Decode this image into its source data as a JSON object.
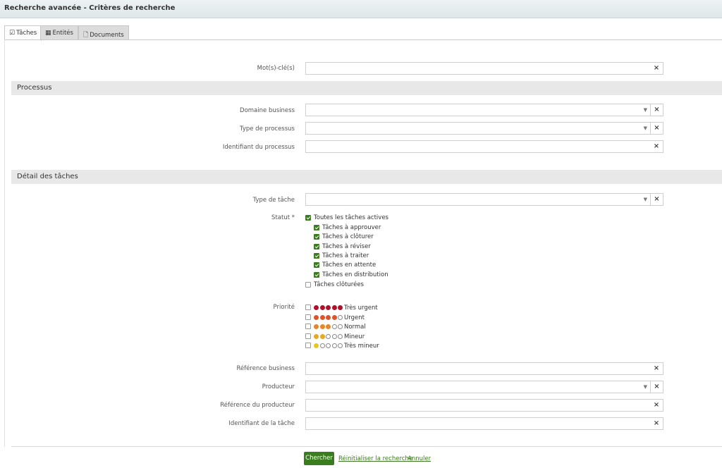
{
  "window": {
    "title": "Recherche avancée - Critères de recherche"
  },
  "tabs": [
    {
      "label": "Tâches",
      "icon": "checkbox-icon",
      "active": true
    },
    {
      "label": "Entités",
      "icon": "building-icon",
      "active": false
    },
    {
      "label": "Documents",
      "icon": "document-icon",
      "active": false
    }
  ],
  "keywords": {
    "label": "Mot(s)-clé(s)",
    "value": "",
    "clear": "×"
  },
  "processus": {
    "title": "Processus",
    "domaine": {
      "label": "Domaine business",
      "value": ""
    },
    "type": {
      "label": "Type de processus",
      "value": ""
    },
    "identifiant": {
      "label": "Identifiant du processus",
      "value": ""
    }
  },
  "details": {
    "title": "Détail des tâches",
    "type_tache": {
      "label": "Type de tâche",
      "value": ""
    },
    "statut": {
      "label": "Statut *",
      "options": [
        {
          "label": "Toutes les tâches actives",
          "checked": true,
          "indent": 0
        },
        {
          "label": "Tâches à approuver",
          "checked": true,
          "indent": 1
        },
        {
          "label": "Tâches à clôturer",
          "checked": true,
          "indent": 1
        },
        {
          "label": "Tâches à réviser",
          "checked": true,
          "indent": 1
        },
        {
          "label": "Tâches à traiter",
          "checked": true,
          "indent": 1
        },
        {
          "label": "Tâches en attente",
          "checked": true,
          "indent": 1
        },
        {
          "label": "Tâches en distribution",
          "checked": true,
          "indent": 1
        },
        {
          "label": "Tâches clôturées",
          "checked": false,
          "indent": 0
        }
      ]
    },
    "priorite": {
      "label": "Priorité",
      "options": [
        {
          "label": "Très urgent",
          "filled": 5,
          "color": "#b0102a"
        },
        {
          "label": "Urgent",
          "filled": 4,
          "color": "#e0522a"
        },
        {
          "label": "Normal",
          "filled": 3,
          "color": "#e8842a"
        },
        {
          "label": "Mineur",
          "filled": 2,
          "color": "#e8a820"
        },
        {
          "label": "Très mineur",
          "filled": 1,
          "color": "#e8c820"
        }
      ]
    },
    "ref_business": {
      "label": "Référence business",
      "value": ""
    },
    "producteur": {
      "label": "Producteur",
      "value": ""
    },
    "ref_producteur": {
      "label": "Référence du producteur",
      "value": ""
    },
    "identifiant_tache": {
      "label": "Identifiant de la tâche",
      "value": ""
    }
  },
  "footer": {
    "search": "Chercher",
    "reset": "Réinitialiser la recherche",
    "cancel": "Annuler"
  },
  "colors": {
    "accent": "#3a7d1e"
  }
}
